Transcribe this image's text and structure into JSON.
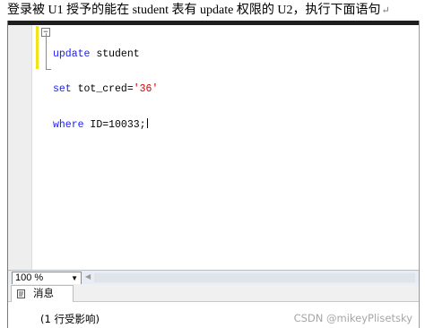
{
  "caption": {
    "text": "登录被 U1 授予的能在 student 表有 update 权限的 U2，执行下面语句",
    "return_mark": "↵"
  },
  "editor": {
    "lines": [
      {
        "keyword": "update",
        "rest": " student"
      },
      {
        "keyword": "set",
        "rest": " tot_cred=",
        "string": "'36'"
      },
      {
        "keyword": "where",
        "rest": " ID=10033;"
      }
    ],
    "collapse_symbol": "−"
  },
  "statusbar": {
    "zoom": "100 %",
    "zoom_arrow": "▼",
    "scroll_left_arrow": "◀"
  },
  "results": {
    "tab_label": "消息",
    "message": "(1 行受影响)"
  },
  "watermark": "CSDN @mikeyPlisetsky",
  "colors": {
    "keyword": "#1a1aff",
    "string": "#d60000",
    "change_bar": "#f2e41a"
  }
}
